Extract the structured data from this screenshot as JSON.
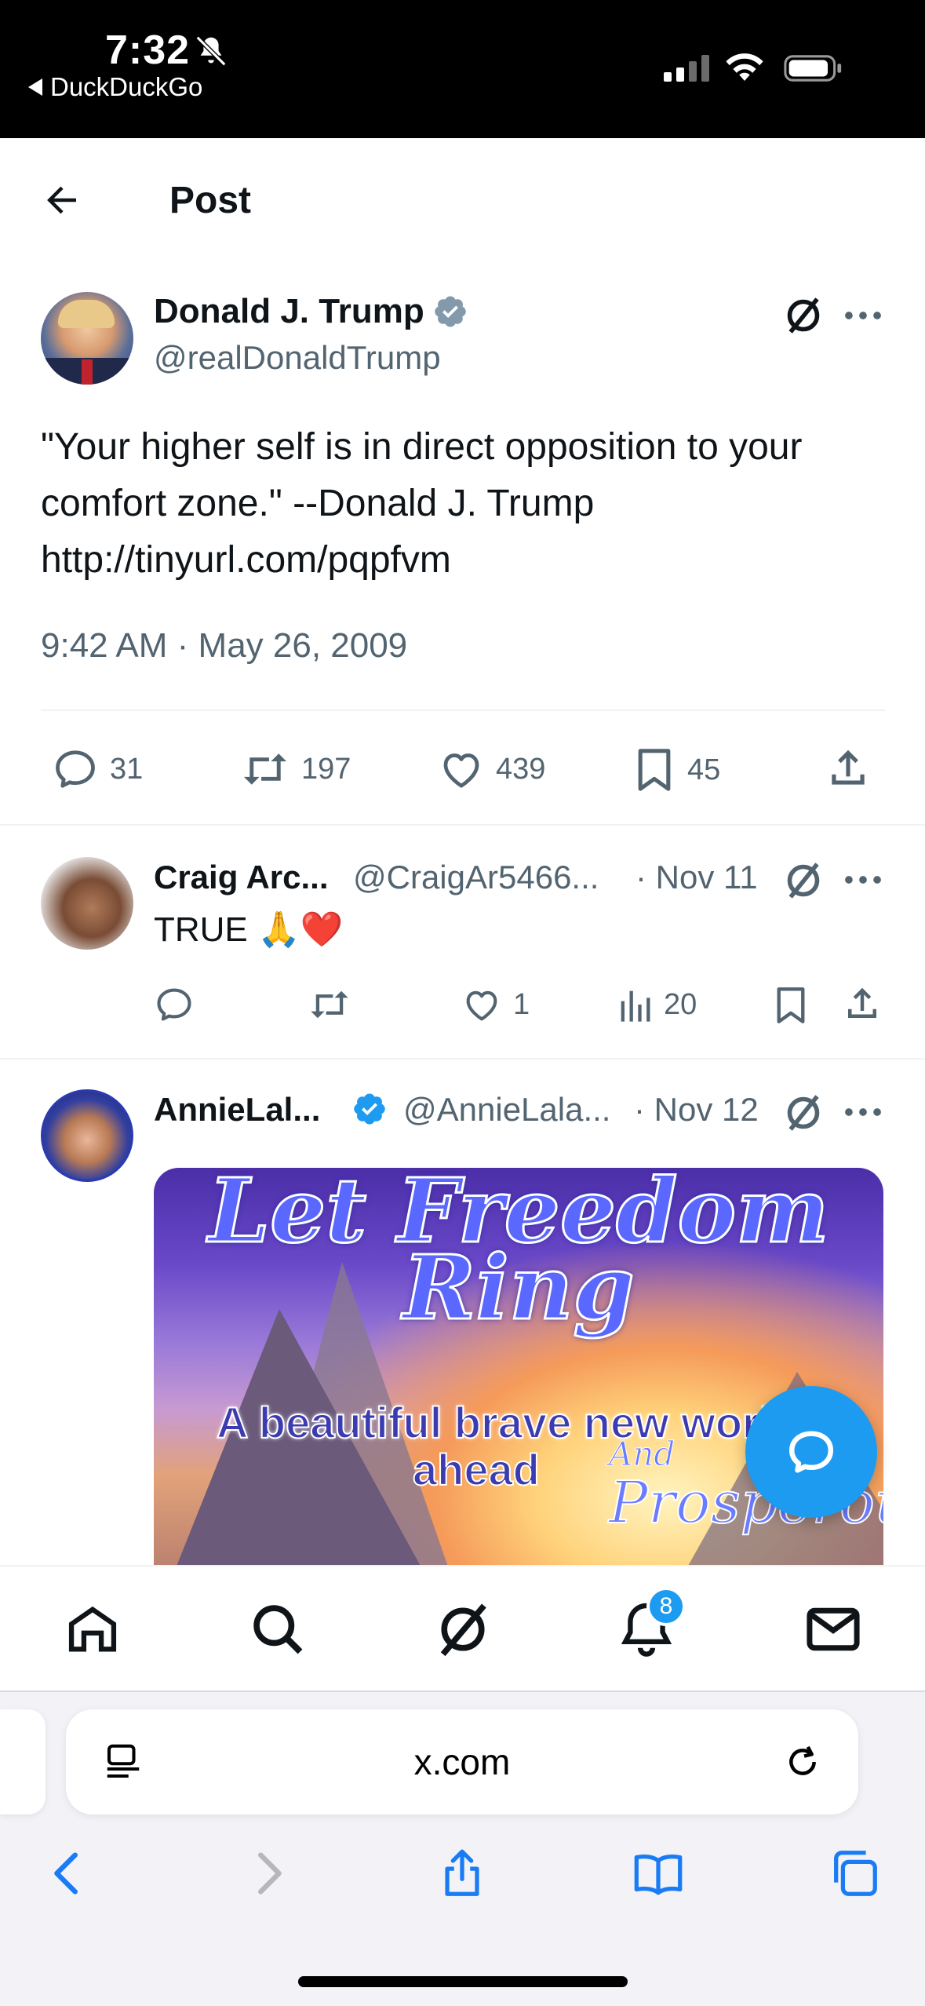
{
  "status_bar": {
    "time": "7:32",
    "back_app": "DuckDuckGo"
  },
  "header": {
    "title": "Post"
  },
  "main_post": {
    "author_name": "Donald J. Trump",
    "author_handle": "@realDonaldTrump",
    "text": "\"Your higher self is in direct opposition to your comfort zone.\" --Donald J. Trump\nhttp://tinyurl.com/pqpfvm",
    "timestamp": "9:42 AM · May 26, 2009",
    "actions": {
      "replies": "31",
      "reposts": "197",
      "likes": "439",
      "bookmarks": "45"
    }
  },
  "replies": [
    {
      "name": "Craig Arc...",
      "handle": "@CraigAr5466...",
      "date": "· Nov 11",
      "text": "TRUE 🙏❤️",
      "actions": {
        "replies": "",
        "reposts": "",
        "likes": "1",
        "views": "20"
      }
    },
    {
      "name": "AnnieLal...",
      "handle": "@AnnieLala...",
      "date": "· Nov 12",
      "image_text": {
        "line1": "Let Freedom",
        "line2": "Ring",
        "line3": "A beautiful brave new world",
        "line4": "ahead",
        "line5": "And",
        "line6": "Prosperous"
      }
    }
  ],
  "tabbar": {
    "notifications_badge": "8"
  },
  "safari": {
    "url": "x.com"
  },
  "colors": {
    "accent": "#1d9bf0",
    "muted": "#536471",
    "text": "#0f1419",
    "like_red": "#f91880"
  },
  "icons": [
    "back-arrow-icon",
    "verified-icon",
    "grok-icon",
    "more-icon",
    "reply-icon",
    "repost-icon",
    "like-icon",
    "bookmark-icon",
    "share-icon",
    "views-icon",
    "home-icon",
    "search-icon",
    "notifications-icon",
    "messages-icon",
    "compose-reply-icon",
    "reader-icon",
    "reload-icon",
    "safari-back-icon",
    "safari-forward-icon",
    "safari-share-icon",
    "safari-bookmarks-icon",
    "safari-tabs-icon"
  ]
}
